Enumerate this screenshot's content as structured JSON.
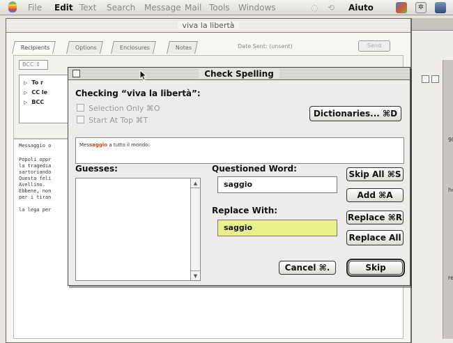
{
  "menubar": {
    "items": [
      "File",
      "Edit",
      "Text",
      "Search",
      "Message",
      "Mail",
      "Tools",
      "Windows"
    ],
    "help": "Aiuto"
  },
  "message_window": {
    "title": "viva la libertà",
    "tabs": [
      "Recipients",
      "Options",
      "Enclosures",
      "Notes"
    ],
    "date_sent": "Date Sent: (unsent)",
    "send_button": "Send",
    "bcc_popup": "BCC",
    "recipients": [
      "To r",
      "CC le",
      "BCC"
    ],
    "body_lines": [
      "Messaggio o",
      "Popoli oppr",
      "la tragedia",
      "sartoriando",
      "Questa feli",
      "Avellino.",
      "Ebbene, non",
      "per i tiran",
      "la lega per"
    ]
  },
  "background_window": {
    "side_texts": [
      "98",
      "he",
      "re"
    ]
  },
  "dialog": {
    "title": "Check Spelling",
    "checking_label": "Checking “viva la libertà”:",
    "selection_only": "Selection Only ⌘O",
    "start_at_top": "Start At Top ⌘T",
    "dictionaries_button": "Dictionaries... ⌘D",
    "context": {
      "before": "Mes",
      "highlight": "saggio",
      "after": " a tutto il mondo:"
    },
    "guesses_label": "Guesses:",
    "questioned_label": "Questioned Word:",
    "questioned_word": "saggio",
    "replace_label": "Replace With:",
    "replace_value": "saggio",
    "skip_all_button": "Skip All ⌘S",
    "add_button": "Add ⌘A",
    "replace_button": "Replace ⌘R",
    "replace_all_button": "Replace All",
    "cancel_button": "Cancel ⌘.",
    "skip_button": "Skip"
  },
  "colors": {
    "highlight_word": "#c84a1c",
    "replace_field_bg": "#e8f08c"
  }
}
